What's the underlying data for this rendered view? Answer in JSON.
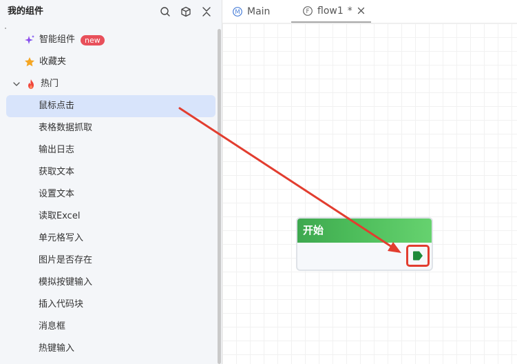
{
  "sidebar": {
    "title": "我的组件",
    "tools": [
      {
        "icon": "search-icon"
      },
      {
        "icon": "cube-icon"
      },
      {
        "icon": "collapse-icon"
      }
    ],
    "items": [
      {
        "label": "智能组件",
        "icon": "sparkle-icon",
        "badge": "new"
      },
      {
        "label": "收藏夹",
        "icon": "star-icon"
      },
      {
        "label": "热门",
        "icon": "fire-icon",
        "expanded": true
      },
      {
        "label": "鼠标点击",
        "selected": true
      },
      {
        "label": "表格数据抓取"
      },
      {
        "label": "输出日志"
      },
      {
        "label": "获取文本"
      },
      {
        "label": "设置文本"
      },
      {
        "label": "读取Excel"
      },
      {
        "label": "单元格写入"
      },
      {
        "label": "图片是否存在"
      },
      {
        "label": "模拟按键输入"
      },
      {
        "label": "插入代码块"
      },
      {
        "label": "消息框"
      },
      {
        "label": "热键输入"
      }
    ]
  },
  "tabs": [
    {
      "label": "Main",
      "icon_letter": "M",
      "active": false
    },
    {
      "label": "flow1",
      "icon_letter": "F",
      "modified": "*",
      "active": true
    }
  ],
  "canvas": {
    "node": {
      "title": "开始"
    }
  },
  "colors": {
    "node_header": "#4cbc5a",
    "port": "#1e8a3a",
    "annotation": "#e23d2f",
    "selection": "#d8e4fb",
    "badge": "#e8505b"
  }
}
